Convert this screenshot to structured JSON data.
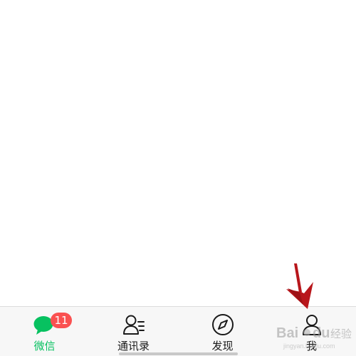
{
  "tabbar": {
    "tabs": [
      {
        "label": "微信",
        "icon": "chat-bubble-icon",
        "active": true,
        "badge": "11"
      },
      {
        "label": "通讯录",
        "icon": "contacts-icon",
        "active": false
      },
      {
        "label": "发现",
        "icon": "compass-icon",
        "active": false
      },
      {
        "label": "我",
        "icon": "person-icon",
        "active": false
      }
    ]
  },
  "colors": {
    "accent": "#07c160",
    "badge": "#fa5151",
    "tabbar_bg": "#f7f7f7",
    "annotation_arrow": "#b8161b"
  },
  "watermark": {
    "brand": "Bai du 经验",
    "url": "jingyan.baidu.com"
  }
}
